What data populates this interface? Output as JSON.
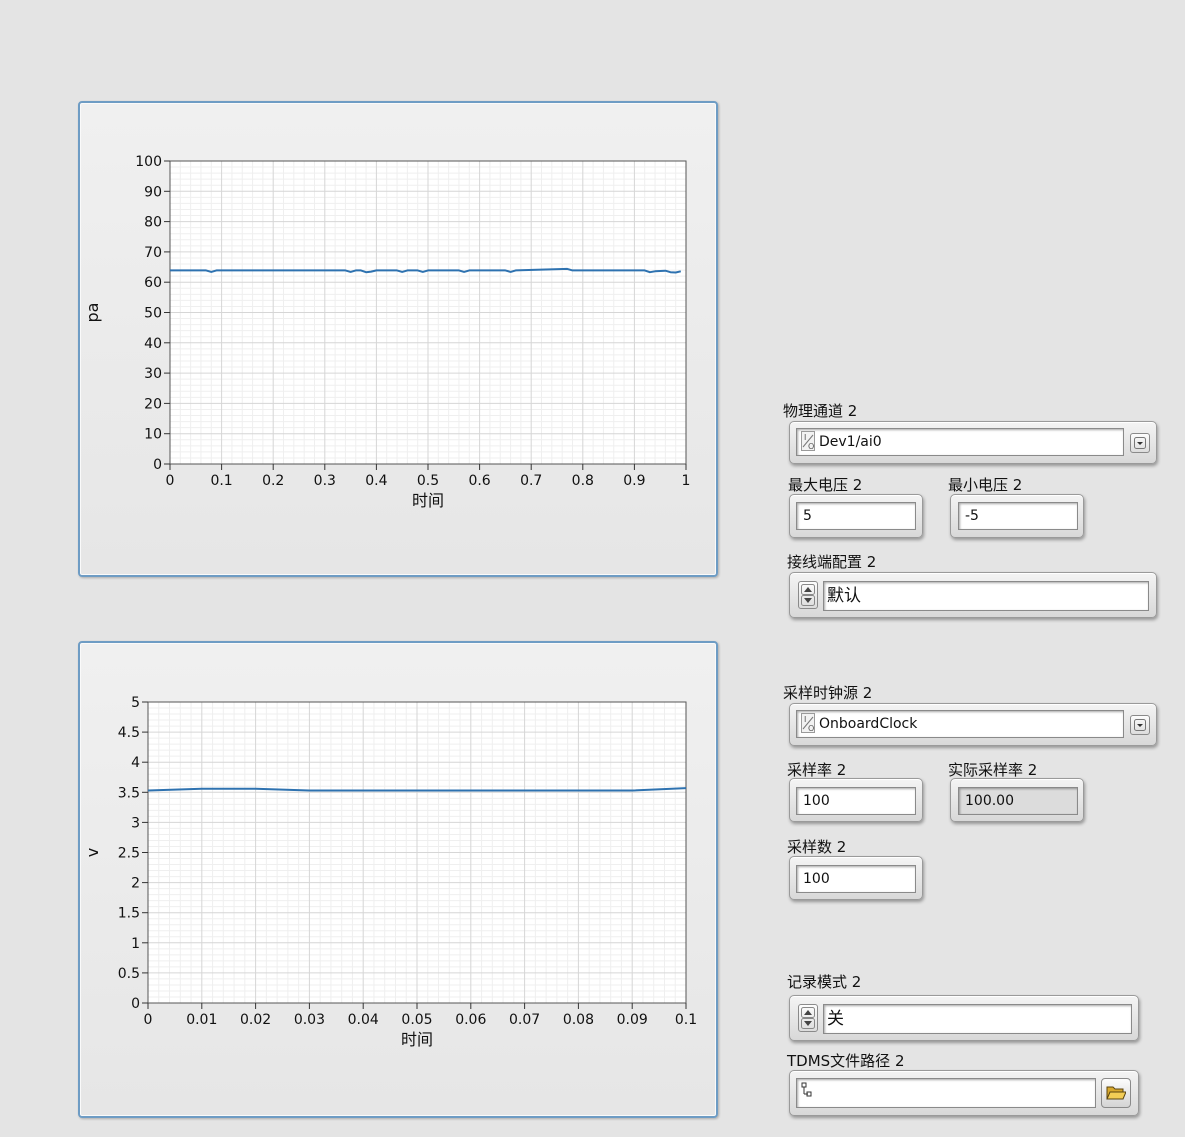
{
  "chart_data": [
    {
      "type": "line",
      "xlabel": "时间",
      "ylabel": "pa",
      "xlim": [
        0,
        1
      ],
      "ylim": [
        0,
        100
      ],
      "x_ticks": [
        "0",
        "0.1",
        "0.2",
        "0.3",
        "0.4",
        "0.5",
        "0.6",
        "0.7",
        "0.8",
        "0.9",
        "1"
      ],
      "y_ticks": [
        "0",
        "10",
        "20",
        "30",
        "40",
        "50",
        "60",
        "70",
        "80",
        "90",
        "100"
      ],
      "grid": true,
      "series": [
        {
          "color": "#2e72b0",
          "x": [
            0,
            0.07,
            0.08,
            0.09,
            0.2,
            0.34,
            0.35,
            0.36,
            0.37,
            0.38,
            0.39,
            0.4,
            0.44,
            0.45,
            0.46,
            0.48,
            0.49,
            0.5,
            0.56,
            0.57,
            0.58,
            0.65,
            0.66,
            0.67,
            0.77,
            0.78,
            0.79,
            0.92,
            0.93,
            0.94,
            0.96,
            0.97,
            0.98,
            0.99
          ],
          "y": [
            63.9,
            63.9,
            63.4,
            63.9,
            63.9,
            63.9,
            63.4,
            63.9,
            63.9,
            63.3,
            63.5,
            63.9,
            63.9,
            63.4,
            63.9,
            63.9,
            63.4,
            63.9,
            63.9,
            63.4,
            63.9,
            63.9,
            63.4,
            63.9,
            64.4,
            63.9,
            63.9,
            63.9,
            63.3,
            63.6,
            63.8,
            63.3,
            63.2,
            63.6
          ]
        }
      ]
    },
    {
      "type": "line",
      "xlabel": "时间",
      "ylabel": "v",
      "xlim": [
        0,
        0.1
      ],
      "ylim": [
        0,
        5
      ],
      "x_ticks": [
        "0",
        "0.01",
        "0.02",
        "0.03",
        "0.04",
        "0.05",
        "0.06",
        "0.07",
        "0.08",
        "0.09",
        "0.1"
      ],
      "y_ticks": [
        "0",
        "0.5",
        "1",
        "1.5",
        "2",
        "2.5",
        "3",
        "3.5",
        "4",
        "4.5",
        "5"
      ],
      "grid": true,
      "series": [
        {
          "color": "#2e72b0",
          "x": [
            0,
            0.01,
            0.02,
            0.03,
            0.04,
            0.05,
            0.06,
            0.07,
            0.08,
            0.09,
            0.1
          ],
          "y": [
            3.53,
            3.56,
            3.56,
            3.53,
            3.53,
            3.53,
            3.53,
            3.53,
            3.53,
            3.53,
            3.57
          ]
        }
      ]
    }
  ],
  "controls": {
    "physical_channel": {
      "label": "物理通道 2",
      "value": "Dev1/ai0"
    },
    "max_voltage": {
      "label": "最大电压 2",
      "value": "5"
    },
    "min_voltage": {
      "label": "最小电压 2",
      "value": "-5"
    },
    "terminal_config": {
      "label": "接线端配置 2",
      "value": "默认"
    },
    "clock_source": {
      "label": "采样时钟源 2",
      "value": "OnboardClock"
    },
    "sample_rate": {
      "label": "采样率 2",
      "value": "100"
    },
    "actual_sample_rate": {
      "label": "实际采样率 2",
      "value": "100.00"
    },
    "samples": {
      "label": "采样数 2",
      "value": "100"
    },
    "logging_mode": {
      "label": "记录模式 2",
      "value": "关"
    },
    "tdms_path": {
      "label": "TDMS文件路径 2",
      "value": ""
    }
  },
  "colors": {
    "plot_line": "#2e72b0",
    "graph_border": "#6e9cc4"
  },
  "icons": {
    "io_name": "io-resource-icon",
    "dropdown": "dropdown-arrow-icon",
    "spin": "up-down-spinner-icon",
    "path": "path-icon",
    "browse": "folder-open-icon"
  }
}
